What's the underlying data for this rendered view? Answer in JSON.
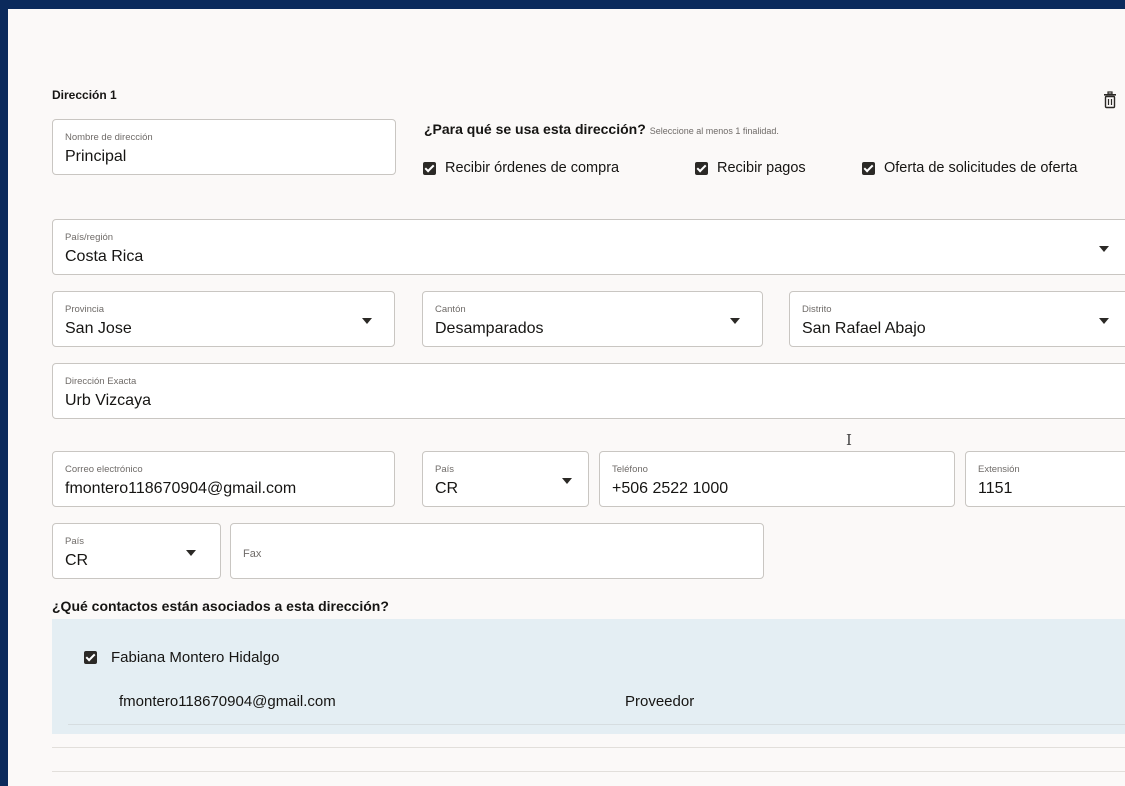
{
  "section": {
    "title": "Dirección 1",
    "delete_icon": "trash-icon"
  },
  "address_name": {
    "label": "Nombre de dirección",
    "value": "Principal"
  },
  "purpose": {
    "question": "¿Para qué se usa esta dirección?",
    "hint": "Seleccione al menos 1 finalidad.",
    "options": [
      {
        "label": "Recibir órdenes de compra",
        "checked": true
      },
      {
        "label": "Recibir pagos",
        "checked": true
      },
      {
        "label": "Oferta de solicitudes de oferta",
        "checked": true
      }
    ]
  },
  "country": {
    "label": "País/región",
    "value": "Costa Rica"
  },
  "province": {
    "label": "Provincia",
    "value": "San Jose"
  },
  "canton": {
    "label": "Cantón",
    "value": "Desamparados"
  },
  "district": {
    "label": "Distrito",
    "value": "San Rafael Abajo"
  },
  "exact_address": {
    "label": "Dirección Exacta",
    "value": "Urb Vizcaya"
  },
  "email": {
    "label": "Correo electrónico",
    "value": "fmontero118670904@gmail.com"
  },
  "phone_country": {
    "label": "País",
    "value": "CR"
  },
  "phone": {
    "label": "Teléfono",
    "value": "+506 2522 1000"
  },
  "extension": {
    "label": "Extensión",
    "value": "1151"
  },
  "fax_country": {
    "label": "País",
    "value": "CR"
  },
  "fax": {
    "placeholder": "Fax",
    "value": ""
  },
  "contacts": {
    "question": "¿Qué contactos están asociados a esta dirección?",
    "items": [
      {
        "name": "Fabiana Montero Hidalgo",
        "email": "fmontero118670904@gmail.com",
        "role": "Proveedor",
        "checked": true
      }
    ]
  },
  "colors": {
    "frame": "#0b2a5c",
    "panel": "#fbf9f8",
    "contact_band": "#e4eef3",
    "checkbox": "#2b2926"
  }
}
